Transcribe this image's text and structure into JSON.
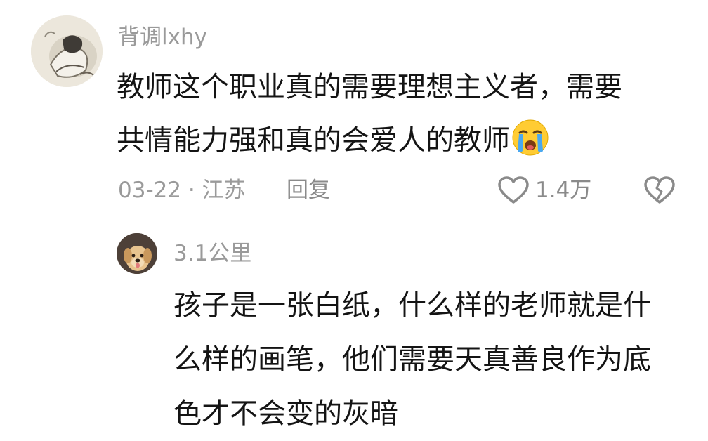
{
  "main_comment": {
    "username": "背调lxhy",
    "line1": "教师这个职业真的需要理想主义者，需要",
    "line2": "共情能力强和真的会爱人的教师",
    "emoji": "loudly-crying-face-icon",
    "date_location": "03-22 · 江苏",
    "reply_label": "回复",
    "like_count": "1.4万"
  },
  "reply_comment": {
    "username": "3.1公里",
    "line1": "孩子是一张白纸，什么样的老师就是什",
    "line2": "么样的画笔，他们需要天真善良作为底",
    "line3": "色才不会变的灰暗"
  },
  "colors": {
    "text": "#141414",
    "muted": "#9a9a9a",
    "background": "#ffffff"
  }
}
